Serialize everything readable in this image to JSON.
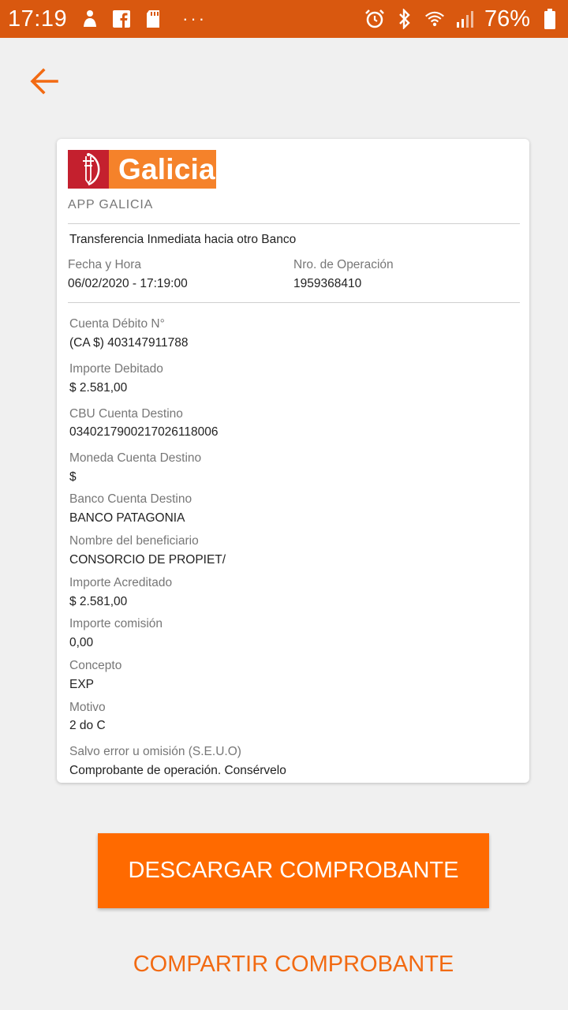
{
  "status_bar": {
    "time": "17:19",
    "battery_text": "76%",
    "more_dots": "···",
    "icons_left": [
      "person-icon",
      "facebook-icon",
      "sd-card-icon"
    ],
    "icons_right": [
      "alarm-icon",
      "bluetooth-icon",
      "wifi-icon",
      "signal-icon",
      "battery-icon"
    ]
  },
  "nav": {
    "back_icon": "arrow-left-icon"
  },
  "receipt": {
    "logo_text": "Galicia",
    "app_name": "APP GALICIA",
    "transfer_type": "Transferencia Inmediata hacia otro Banco",
    "date_label": "Fecha y Hora",
    "date_value": "06/02/2020 -  17:19:00",
    "operation_label": "Nro. de Operación",
    "operation_value": "1959368410",
    "fields": [
      {
        "label": "Cuenta Débito N°",
        "value": "(CA $) 403147911788"
      },
      {
        "label": "Importe Debitado",
        "value": "$ 2.581,00"
      },
      {
        "label": "CBU Cuenta Destino",
        "value": "0340217900217026118006"
      },
      {
        "label": "Moneda Cuenta Destino",
        "value": "$"
      },
      {
        "label": "Banco Cuenta Destino",
        "value": "BANCO PATAGONIA"
      },
      {
        "label": "Nombre del beneficiario",
        "value": "CONSORCIO DE PROPIET/"
      },
      {
        "label": "Importe Acreditado",
        "value": "$ 2.581,00"
      },
      {
        "label": "Importe comisión",
        "value": "0,00"
      },
      {
        "label": "Concepto",
        "value": "EXP"
      },
      {
        "label": "Motivo",
        "value": "2 do C"
      },
      {
        "label": "Salvo error u omisión (S.E.U.O)",
        "value": "Comprobante de operación. Consérvelo"
      }
    ]
  },
  "actions": {
    "download_label": "DESCARGAR COMPROBANTE",
    "share_label": "COMPARTIR COMPROBANTE"
  },
  "colors": {
    "status_bar": "#d9580f",
    "accent": "#ff6a00",
    "link": "#f26a12",
    "galicia_orange": "#f5822a",
    "galicia_red": "#c4202e"
  }
}
